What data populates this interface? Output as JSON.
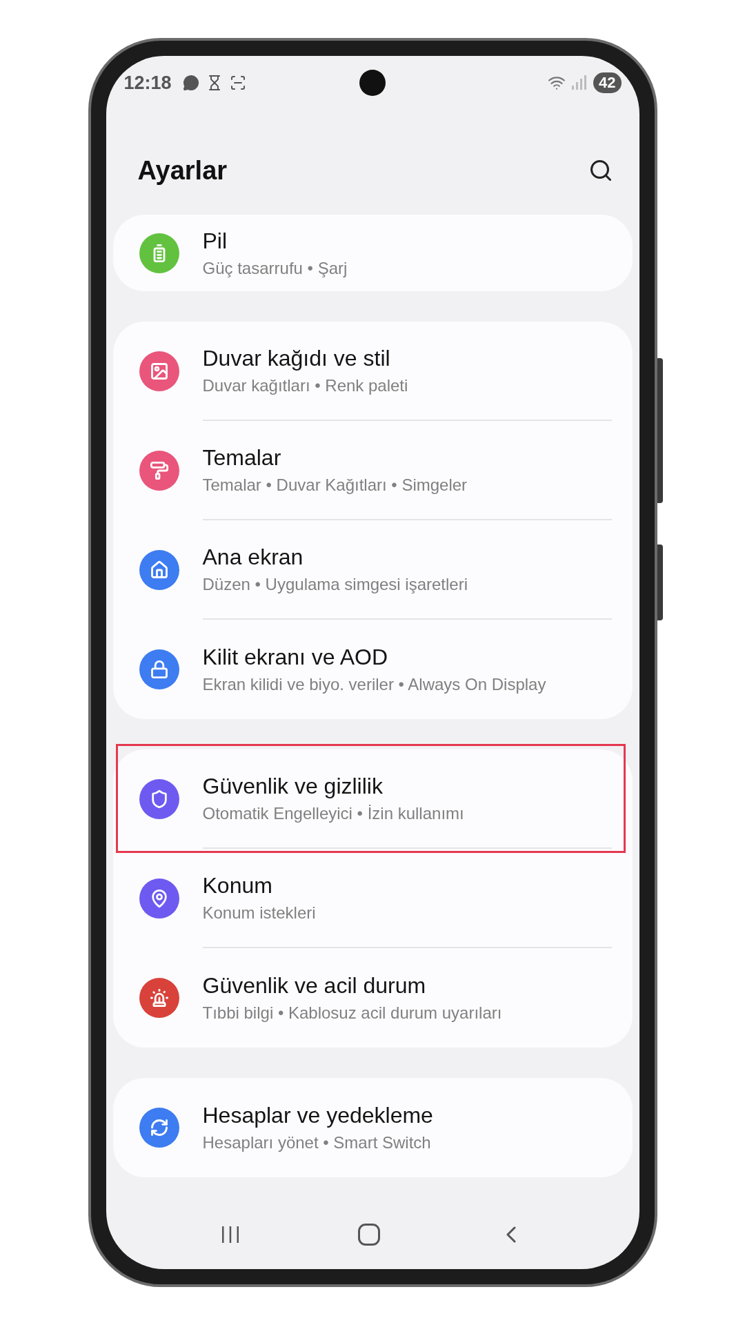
{
  "status_bar": {
    "time": "12:18",
    "battery": "42"
  },
  "header": {
    "title": "Ayarlar"
  },
  "groups": [
    {
      "items": [
        {
          "color": "#62c23f",
          "title": "Pil",
          "subtitle": "Güç tasarrufu • Şarj",
          "highlighted": false
        }
      ]
    },
    {
      "items": [
        {
          "color": "#e9557b",
          "title": "Duvar kağıdı ve stil",
          "subtitle": "Duvar kağıtları • Renk paleti",
          "highlighted": false
        },
        {
          "color": "#e9557b",
          "title": "Temalar",
          "subtitle": "Temalar • Duvar Kağıtları • Simgeler",
          "highlighted": false
        },
        {
          "color": "#3d7cf1",
          "title": "Ana ekran",
          "subtitle": "Düzen • Uygulama simgesi işaretleri",
          "highlighted": false
        },
        {
          "color": "#3d7cf1",
          "title": "Kilit ekranı ve AOD",
          "subtitle": "Ekran kilidi ve biyo. veriler • Always On Display",
          "highlighted": false
        }
      ]
    },
    {
      "items": [
        {
          "color": "#6e5af0",
          "title": "Güvenlik ve gizlilik",
          "subtitle": "Otomatik Engelleyici • İzin kullanımı",
          "highlighted": true
        },
        {
          "color": "#6e5af0",
          "title": "Konum",
          "subtitle": "Konum istekleri",
          "highlighted": false
        },
        {
          "color": "#d8423a",
          "title": "Güvenlik ve acil durum",
          "subtitle": "Tıbbi bilgi • Kablosuz acil durum uyarıları",
          "highlighted": false
        }
      ]
    },
    {
      "items": [
        {
          "color": "#3d7cf1",
          "title": "Hesaplar ve yedekleme",
          "subtitle": "Hesapları yönet • Smart Switch",
          "highlighted": false
        }
      ]
    }
  ]
}
